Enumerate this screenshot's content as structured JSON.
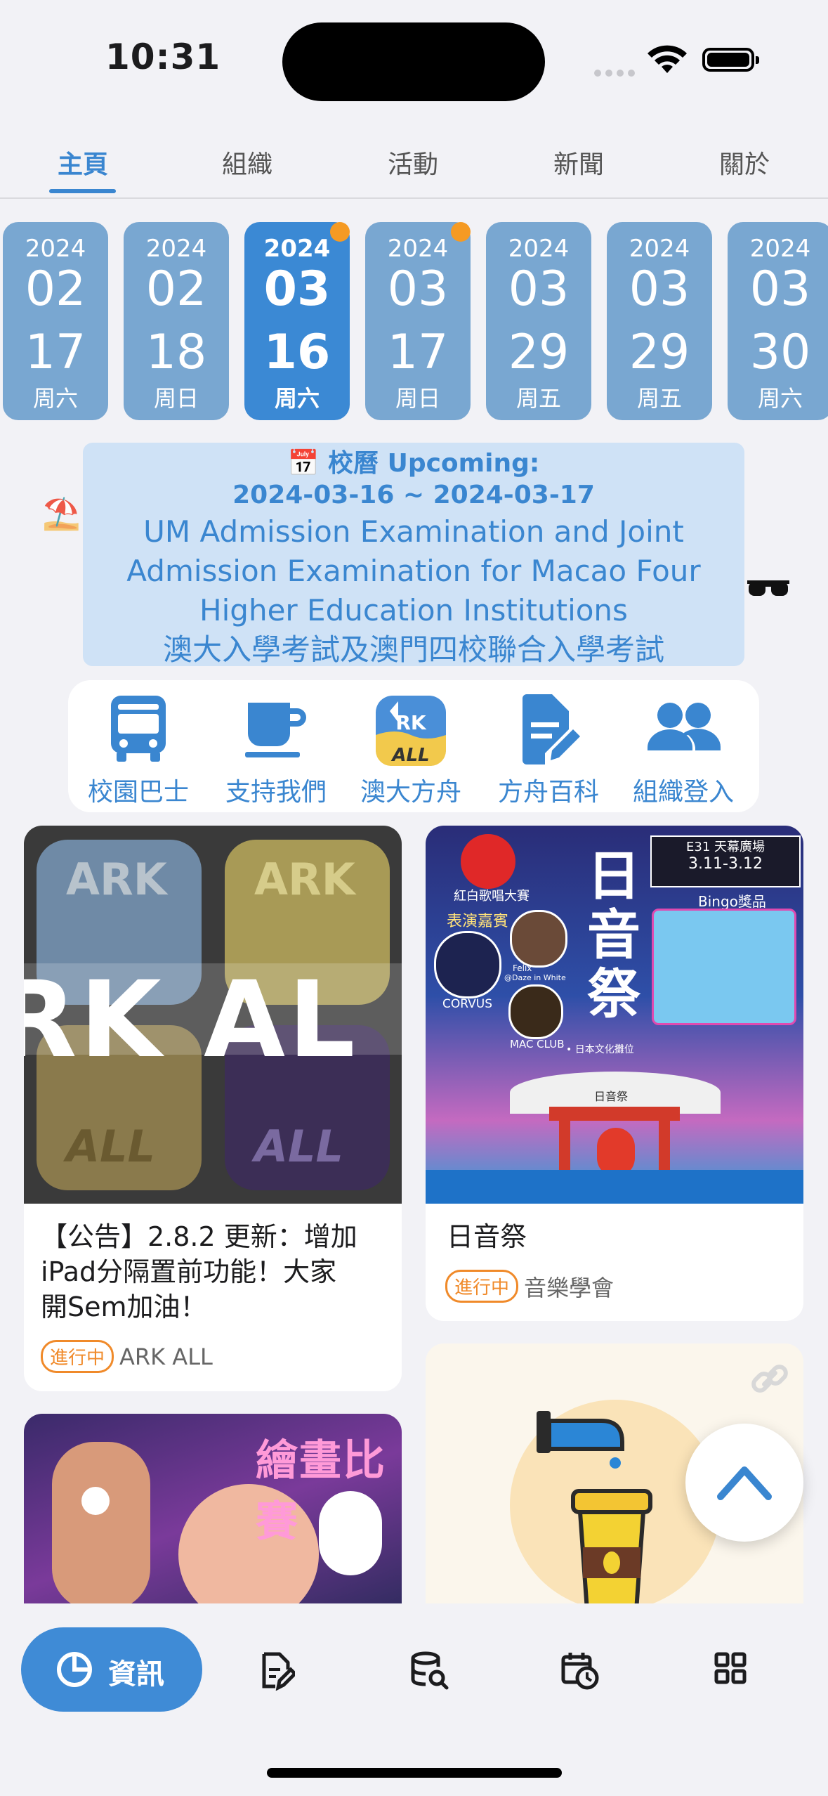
{
  "status": {
    "time": "10:31"
  },
  "tabs": [
    {
      "label": "主頁",
      "active": true
    },
    {
      "label": "組織",
      "active": false
    },
    {
      "label": "活動",
      "active": false
    },
    {
      "label": "新聞",
      "active": false
    },
    {
      "label": "關於",
      "active": false
    }
  ],
  "dates": [
    {
      "year": "2024",
      "month": "02",
      "day": "17",
      "weekday": "周六",
      "active": false,
      "dot": false
    },
    {
      "year": "2024",
      "month": "02",
      "day": "18",
      "weekday": "周日",
      "active": false,
      "dot": false
    },
    {
      "year": "2024",
      "month": "03",
      "day": "16",
      "weekday": "周六",
      "active": true,
      "dot": true
    },
    {
      "year": "2024",
      "month": "03",
      "day": "17",
      "weekday": "周日",
      "active": false,
      "dot": true
    },
    {
      "year": "2024",
      "month": "03",
      "day": "29",
      "weekday": "周五",
      "active": false,
      "dot": false
    },
    {
      "year": "2024",
      "month": "03",
      "day": "29",
      "weekday": "周五",
      "active": false,
      "dot": false
    },
    {
      "year": "2024",
      "month": "03",
      "day": "30",
      "weekday": "周六",
      "active": false,
      "dot": false
    }
  ],
  "banner": {
    "heading_icon": "📅",
    "heading": "校曆 Upcoming:",
    "range": "2024-03-16 ~ 2024-03-17",
    "line1": "UM Admission Examination and Joint",
    "line2": "Admission Examination for Macao Four",
    "line3": "Higher Education Institutions",
    "line4": "澳大入學考試及澳門四校聯合入學考試",
    "left_emoji": "⛱️",
    "right_emoji": "sunglasses"
  },
  "actions": [
    {
      "label": "校園巴士",
      "icon": "bus-icon"
    },
    {
      "label": "支持我們",
      "icon": "coffee-cup-icon"
    },
    {
      "label": "澳大方舟",
      "icon": "ark-all-logo-icon"
    },
    {
      "label": "方舟百科",
      "icon": "document-edit-icon"
    },
    {
      "label": "組織登入",
      "icon": "people-icon"
    }
  ],
  "ark_logo_text": {
    "top": "RK",
    "bottom": "ALL"
  },
  "cards": [
    {
      "title": "【公告】2.8.2 更新：增加 iPad分隔置前功能！大家開Sem加油！",
      "title_lines": [
        "【公告】2.8.2 更新：增加",
        " iPad分隔置前功能！大家",
        "開Sem加油！"
      ],
      "badge": "進行中",
      "org": "ARK ALL",
      "image_text": "RK AL",
      "tile_text": [
        "ARK",
        "ALL"
      ]
    },
    {
      "title": "日音祭",
      "badge": "進行中",
      "org": "音樂學會",
      "poster": {
        "title": "日音祭",
        "venue": "E31 天幕廣場",
        "dates": "3.11-3.12",
        "bingo": "Bingo獎品",
        "red": "紅白歌唱大賽",
        "guests": "表演嘉賓",
        "corvus": "CORVUS",
        "mac": "MAC CLUB",
        "felix": "Felix",
        "felix2": "@Daze in White",
        "shrine": "日音祭",
        "culture": "• 日本文化攤位"
      }
    },
    {
      "title": "繪畫比賽",
      "poster_title": "繪畫比賽"
    },
    {
      "title": "",
      "image": "coffee-drip-illustration"
    }
  ],
  "bottom_nav": [
    {
      "label": "資訊",
      "icon": "pie-chart-icon",
      "active": true
    },
    {
      "label": "",
      "icon": "edit-document-icon",
      "active": false
    },
    {
      "label": "",
      "icon": "database-search-icon",
      "active": false
    },
    {
      "label": "",
      "icon": "calendar-clock-icon",
      "active": false
    },
    {
      "label": "",
      "icon": "grid-icon",
      "active": false
    }
  ],
  "fab": {
    "icon": "chevron-up-icon"
  },
  "colors": {
    "accent": "#3a86d0",
    "date_bg": "#79a7d1",
    "date_active": "#3b89d4",
    "dot": "#f59a23",
    "badge": "#f08a2a"
  }
}
